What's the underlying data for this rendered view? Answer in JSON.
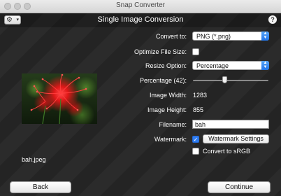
{
  "window": {
    "title": "Snap Converter"
  },
  "header": {
    "title": "Single Image Conversion",
    "help_label": "?"
  },
  "preview": {
    "filename": "bah.jpeg"
  },
  "form": {
    "convert_to": {
      "label": "Convert to:",
      "value": "PNG (*.png)"
    },
    "optimize": {
      "label": "Optimize File Size:",
      "checked": false
    },
    "resize_option": {
      "label": "Resize Option:",
      "value": "Percentage"
    },
    "percentage": {
      "label": "Percentage (42):",
      "value": 42
    },
    "image_width": {
      "label": "Image Width:",
      "value": "1283"
    },
    "image_height": {
      "label": "Image Height:",
      "value": "855"
    },
    "filename": {
      "label": "Filename:",
      "value": "bah"
    },
    "watermark": {
      "label": "Watermark:",
      "checked": true,
      "settings_label": "Watermark Settings"
    },
    "srgb": {
      "label": "Convert to sRGB",
      "checked": false
    }
  },
  "footer": {
    "back_label": "Back",
    "continue_label": "Continue"
  },
  "colors": {
    "accent": "#2f7cf0",
    "background": "#2a2a2a",
    "text": "#ffffff"
  }
}
